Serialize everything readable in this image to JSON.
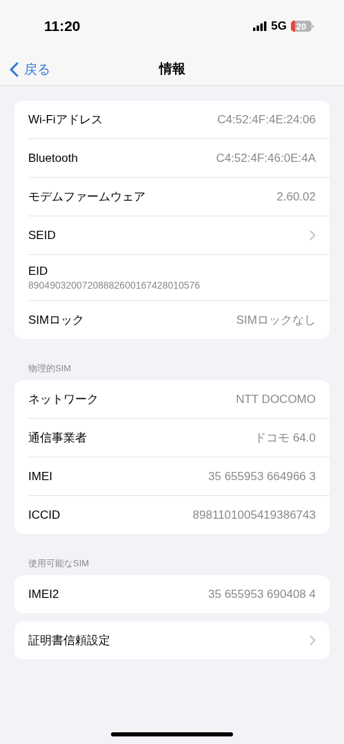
{
  "status_bar": {
    "time": "11:20",
    "network": "5G",
    "battery": "20"
  },
  "nav": {
    "back": "戻る",
    "title": "情報"
  },
  "sections": [
    {
      "rows": [
        {
          "kind": "value",
          "label": "Wi-Fiアドレス",
          "value": "C4:52:4F:4E:24:06"
        },
        {
          "kind": "value",
          "label": "Bluetooth",
          "value": "C4:52:4F:46:0E:4A"
        },
        {
          "kind": "value",
          "label": "モデムファームウェア",
          "value": "2.60.02"
        },
        {
          "kind": "link",
          "label": "SEID"
        },
        {
          "kind": "stacked",
          "label": "EID",
          "value": "89049032007208882600167428010576"
        },
        {
          "kind": "value",
          "label": "SIMロック",
          "value": "SIMロックなし"
        }
      ]
    },
    {
      "header": "物理的SIM",
      "rows": [
        {
          "kind": "value",
          "label": "ネットワーク",
          "value": "NTT DOCOMO"
        },
        {
          "kind": "value",
          "label": "通信事業者",
          "value": "ドコモ 64.0"
        },
        {
          "kind": "value",
          "label": "IMEI",
          "value": "35 655953 664966 3"
        },
        {
          "kind": "value",
          "label": "ICCID",
          "value": "8981101005419386743"
        }
      ]
    },
    {
      "header": "使用可能なSIM",
      "rows": [
        {
          "kind": "value",
          "label": "IMEI2",
          "value": "35 655953 690408 4"
        }
      ]
    },
    {
      "rows": [
        {
          "kind": "link",
          "label": "証明書信頼設定"
        }
      ]
    }
  ]
}
